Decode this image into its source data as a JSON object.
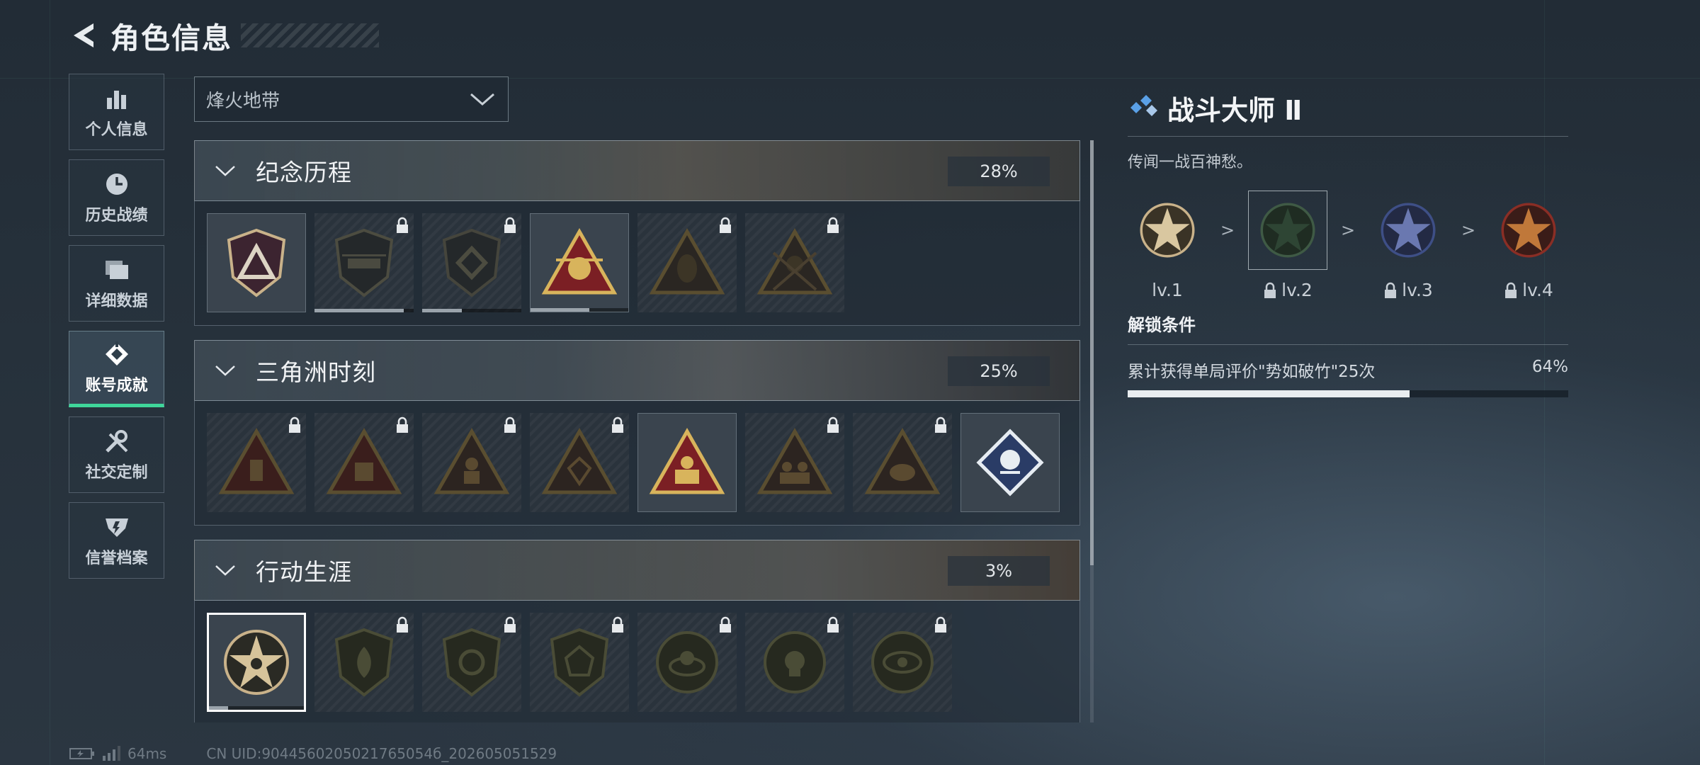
{
  "header": {
    "title": "角色信息",
    "back_icon": "back-arrow-icon"
  },
  "nav": {
    "items": [
      {
        "label": "个人信息",
        "icon": "bar-chart-icon",
        "active": false
      },
      {
        "label": "历史战绩",
        "icon": "clock-icon",
        "active": false
      },
      {
        "label": "详细数据",
        "icon": "folder-icon",
        "active": false
      },
      {
        "label": "账号成就",
        "icon": "achievement-icon",
        "active": true
      },
      {
        "label": "社交定制",
        "icon": "tools-icon",
        "active": false
      },
      {
        "label": "信誉档案",
        "icon": "shield-icon",
        "active": false
      }
    ],
    "active_color": "#3fd69a"
  },
  "mode_select": {
    "value": "烽火地带"
  },
  "sections": [
    {
      "name": "纪念历程",
      "percent": "28%",
      "badges": [
        {
          "icon": "triangle-shield-badge-icon",
          "locked": false,
          "progress": null
        },
        {
          "icon": "helicopter-badge-icon",
          "locked": true,
          "progress": 0.9
        },
        {
          "icon": "diamond-shield-badge-icon",
          "locked": true,
          "progress": 0.4
        },
        {
          "icon": "helicopter-triangle-badge-icon",
          "locked": false,
          "progress": 0.6
        },
        {
          "icon": "hooded-figure-badge-icon",
          "locked": true,
          "progress": null
        },
        {
          "icon": "soldier-rifles-badge-icon",
          "locked": true,
          "progress": null
        }
      ]
    },
    {
      "name": "三角洲时刻",
      "percent": "25%",
      "badges": [
        {
          "icon": "item-triangle-badge-icon",
          "locked": true
        },
        {
          "icon": "box-triangle-badge-icon",
          "locked": true
        },
        {
          "icon": "figure-triangle-badge-icon",
          "locked": true
        },
        {
          "icon": "gem-triangle-badge-icon",
          "locked": true
        },
        {
          "icon": "team-triangle-badge-icon",
          "locked": false
        },
        {
          "icon": "squad-triangle-badge-icon",
          "locked": true
        },
        {
          "icon": "beast-triangle-badge-icon",
          "locked": true
        },
        {
          "icon": "rose-diamond-badge-icon",
          "locked": false
        }
      ]
    },
    {
      "name": "行动生涯",
      "percent": "3%",
      "badges": [
        {
          "icon": "star-medal-badge-icon",
          "locked": false,
          "selected": true,
          "progress": 0.2
        },
        {
          "icon": "flame-shield-badge-icon",
          "locked": true
        },
        {
          "icon": "wing-shield-badge-icon",
          "locked": true
        },
        {
          "icon": "gem-shield-badge-icon",
          "locked": true
        },
        {
          "icon": "orbit-medal-badge-icon",
          "locked": true
        },
        {
          "icon": "skull-medal-badge-icon",
          "locked": true
        },
        {
          "icon": "eye-medal-badge-icon",
          "locked": true
        }
      ]
    }
  ],
  "detail": {
    "name": "战斗大师 Ⅱ",
    "description": "传闻一战百神愁。",
    "levels": [
      {
        "label": "lv.1",
        "locked": false,
        "color": "#c9b28a"
      },
      {
        "label": "lv.2",
        "locked": true,
        "color": "#3f5a45",
        "selected": true
      },
      {
        "label": "lv.3",
        "locked": true,
        "color": "#3e4f86"
      },
      {
        "label": "lv.4",
        "locked": true,
        "color": "#8a2e25"
      }
    ],
    "separator": ">",
    "unlock_title": "解锁条件",
    "condition": "累计获得单局评价\"势如破竹\"25次",
    "condition_percent": "64%",
    "condition_progress": 0.64
  },
  "footer": {
    "ping": "64ms",
    "uid": "CN UID:9044560205021765054б_202605051529"
  }
}
